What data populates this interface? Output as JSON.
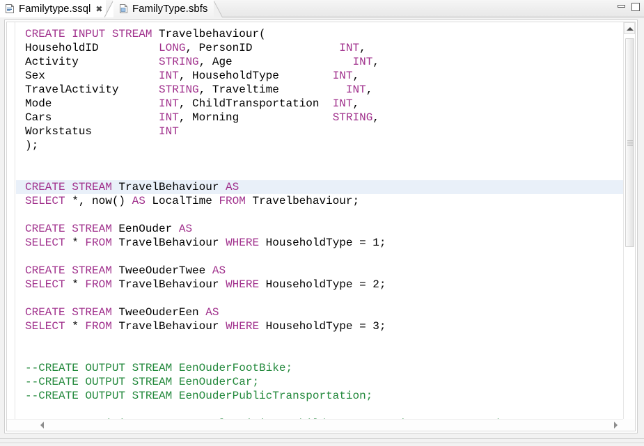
{
  "window": {
    "minimize_label": "Minimize",
    "maximize_label": "Maximize"
  },
  "tabs": [
    {
      "label": "Familytype.ssql",
      "icon": "ssql-file-icon",
      "active": true,
      "close_glyph": "✖"
    },
    {
      "label": "FamilyType.sbfs",
      "icon": "sbfs-file-icon",
      "active": false
    }
  ],
  "editor": {
    "highlighted_line_index": 11,
    "colors": {
      "keyword": "#a0308c",
      "comment": "#22883b",
      "text": "#000000",
      "current_line_highlight": "#e9f0f9",
      "background": "#ffffff"
    },
    "lines": [
      [
        {
          "t": "CREATE INPUT STREAM ",
          "c": "kw"
        },
        {
          "t": "Travelbehaviour(",
          "c": ""
        }
      ],
      [
        {
          "t": "HouseholdID         ",
          "c": ""
        },
        {
          "t": "LONG",
          "c": "kw"
        },
        {
          "t": ", PersonID             ",
          "c": ""
        },
        {
          "t": "INT",
          "c": "kw"
        },
        {
          "t": ",",
          "c": ""
        }
      ],
      [
        {
          "t": "Activity            ",
          "c": ""
        },
        {
          "t": "STRING",
          "c": "kw"
        },
        {
          "t": ", Age                  ",
          "c": ""
        },
        {
          "t": "INT",
          "c": "kw"
        },
        {
          "t": ",",
          "c": ""
        }
      ],
      [
        {
          "t": "Sex                 ",
          "c": ""
        },
        {
          "t": "INT",
          "c": "kw"
        },
        {
          "t": ", HouseholdType        ",
          "c": ""
        },
        {
          "t": "INT",
          "c": "kw"
        },
        {
          "t": ",",
          "c": ""
        }
      ],
      [
        {
          "t": "TravelActivity      ",
          "c": ""
        },
        {
          "t": "STRING",
          "c": "kw"
        },
        {
          "t": ", Traveltime          ",
          "c": ""
        },
        {
          "t": "INT",
          "c": "kw"
        },
        {
          "t": ",",
          "c": ""
        }
      ],
      [
        {
          "t": "Mode                ",
          "c": ""
        },
        {
          "t": "INT",
          "c": "kw"
        },
        {
          "t": ", ChildTransportation  ",
          "c": ""
        },
        {
          "t": "INT",
          "c": "kw"
        },
        {
          "t": ",",
          "c": ""
        }
      ],
      [
        {
          "t": "Cars                ",
          "c": ""
        },
        {
          "t": "INT",
          "c": "kw"
        },
        {
          "t": ", Morning              ",
          "c": ""
        },
        {
          "t": "STRING",
          "c": "kw"
        },
        {
          "t": ",",
          "c": ""
        }
      ],
      [
        {
          "t": "Workstatus          ",
          "c": ""
        },
        {
          "t": "INT",
          "c": "kw"
        }
      ],
      [
        {
          "t": ");",
          "c": ""
        }
      ],
      [
        {
          "t": "",
          "c": ""
        }
      ],
      [
        {
          "t": "",
          "c": ""
        }
      ],
      [
        {
          "t": "CREATE STREAM ",
          "c": "kw"
        },
        {
          "t": "TravelBehaviour ",
          "c": ""
        },
        {
          "t": "AS",
          "c": "kw"
        }
      ],
      [
        {
          "t": "SELECT",
          "c": "kw"
        },
        {
          "t": " *, now() ",
          "c": ""
        },
        {
          "t": "AS",
          "c": "kw"
        },
        {
          "t": " LocalTime ",
          "c": ""
        },
        {
          "t": "FROM",
          "c": "kw"
        },
        {
          "t": " Travelbehaviour;",
          "c": ""
        }
      ],
      [
        {
          "t": "",
          "c": ""
        }
      ],
      [
        {
          "t": "CREATE STREAM ",
          "c": "kw"
        },
        {
          "t": "EenOuder ",
          "c": ""
        },
        {
          "t": "AS",
          "c": "kw"
        }
      ],
      [
        {
          "t": "SELECT",
          "c": "kw"
        },
        {
          "t": " * ",
          "c": ""
        },
        {
          "t": "FROM",
          "c": "kw"
        },
        {
          "t": " TravelBehaviour ",
          "c": ""
        },
        {
          "t": "WHERE",
          "c": "kw"
        },
        {
          "t": " HouseholdType = 1;",
          "c": ""
        }
      ],
      [
        {
          "t": "",
          "c": ""
        }
      ],
      [
        {
          "t": "CREATE STREAM ",
          "c": "kw"
        },
        {
          "t": "TweeOuderTwee ",
          "c": ""
        },
        {
          "t": "AS",
          "c": "kw"
        }
      ],
      [
        {
          "t": "SELECT",
          "c": "kw"
        },
        {
          "t": " * ",
          "c": ""
        },
        {
          "t": "FROM",
          "c": "kw"
        },
        {
          "t": " TravelBehaviour ",
          "c": ""
        },
        {
          "t": "WHERE",
          "c": "kw"
        },
        {
          "t": " HouseholdType = 2;",
          "c": ""
        }
      ],
      [
        {
          "t": "",
          "c": ""
        }
      ],
      [
        {
          "t": "CREATE STREAM ",
          "c": "kw"
        },
        {
          "t": "TweeOuderEen ",
          "c": ""
        },
        {
          "t": "AS",
          "c": "kw"
        }
      ],
      [
        {
          "t": "SELECT",
          "c": "kw"
        },
        {
          "t": " * ",
          "c": ""
        },
        {
          "t": "FROM",
          "c": "kw"
        },
        {
          "t": " TravelBehaviour ",
          "c": ""
        },
        {
          "t": "WHERE",
          "c": "kw"
        },
        {
          "t": " HouseholdType = 3;",
          "c": ""
        }
      ],
      [
        {
          "t": "",
          "c": ""
        }
      ],
      [
        {
          "t": "",
          "c": ""
        }
      ],
      [
        {
          "t": "--CREATE OUTPUT STREAM EenOuderFootBike;",
          "c": "cmt"
        }
      ],
      [
        {
          "t": "--CREATE OUTPUT STREAM EenOuderCar;",
          "c": "cmt"
        }
      ],
      [
        {
          "t": "--CREATE OUTPUT STREAM EenOuderPublicTransportation;",
          "c": "cmt"
        }
      ],
      [
        {
          "t": "",
          "c": ""
        }
      ],
      [
        {
          "t": "--SELECT Activity, Age, TravelActivity, ChildTransportation FROM EenOuder",
          "c": "cmt"
        }
      ]
    ]
  },
  "scrollbars": {
    "vertical": {
      "up_arrow": "scroll-up-arrow",
      "thumb_top_pct": 4,
      "thumb_height_pct": 54
    },
    "horizontal": {
      "left_arrow": "scroll-left-arrow",
      "right_arrow": "scroll-right-arrow"
    }
  }
}
